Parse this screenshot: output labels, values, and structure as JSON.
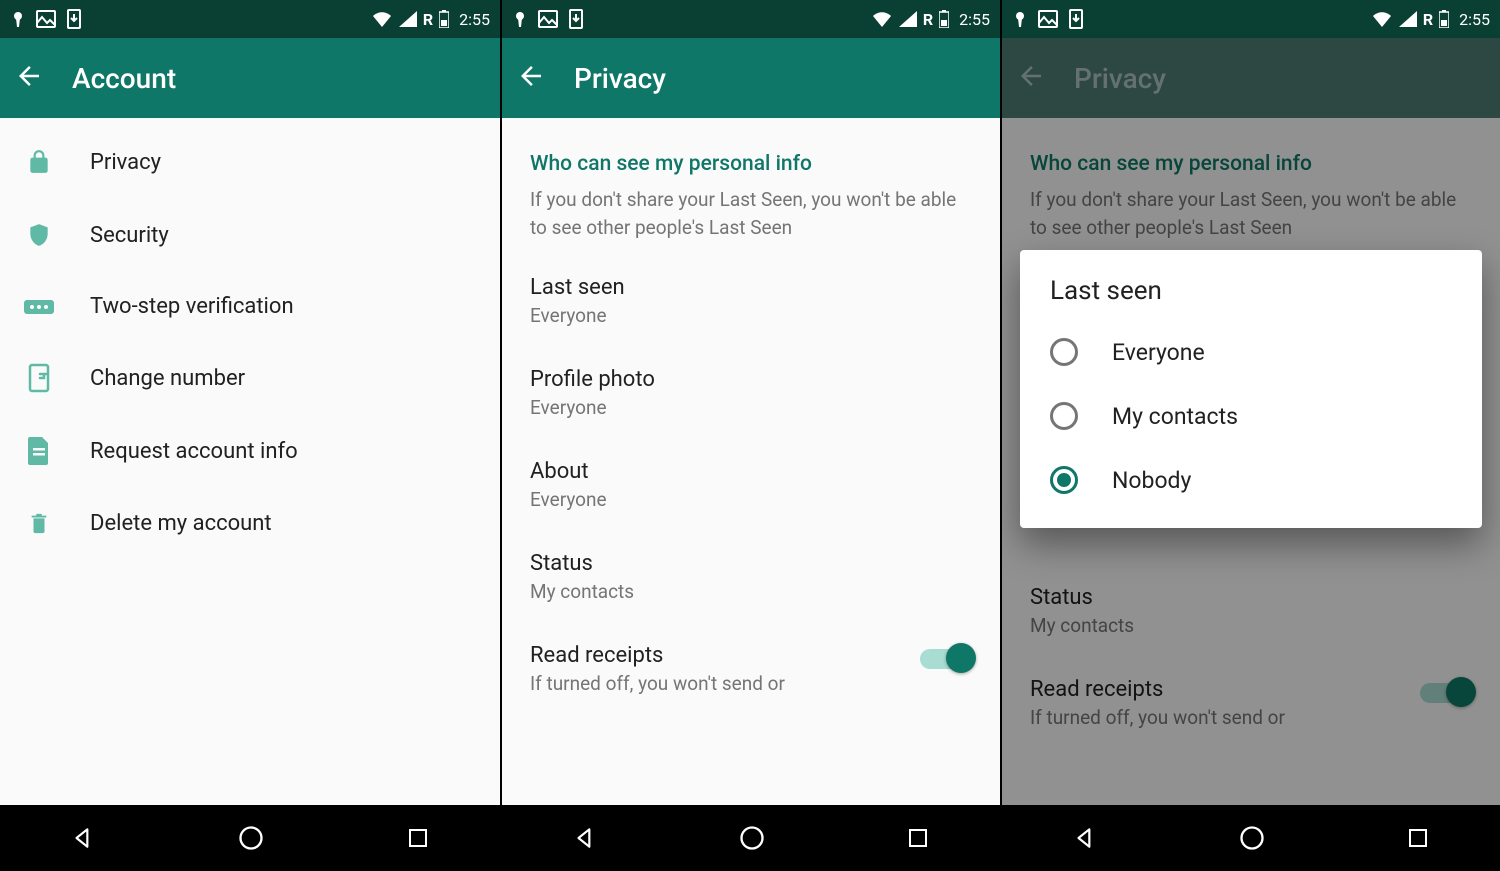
{
  "status": {
    "time": "2:55",
    "network": "R"
  },
  "screens": [
    {
      "title": "Account",
      "items": [
        {
          "name": "privacy",
          "label": "Privacy",
          "icon": "lock-icon"
        },
        {
          "name": "security",
          "label": "Security",
          "icon": "shield-icon"
        },
        {
          "name": "two-step",
          "label": "Two-step verification",
          "icon": "passcode-icon"
        },
        {
          "name": "change-number",
          "label": "Change number",
          "icon": "sim-icon"
        },
        {
          "name": "request-info",
          "label": "Request account info",
          "icon": "document-icon"
        },
        {
          "name": "delete-account",
          "label": "Delete my account",
          "icon": "trash-icon"
        }
      ]
    },
    {
      "title": "Privacy",
      "section_header": "Who can see my personal info",
      "section_caption": "If you don't share your Last Seen, you won't be able to see other people's Last Seen",
      "items": [
        {
          "name": "last-seen",
          "title": "Last seen",
          "sub": "Everyone"
        },
        {
          "name": "profile-photo",
          "title": "Profile photo",
          "sub": "Everyone"
        },
        {
          "name": "about",
          "title": "About",
          "sub": "Everyone"
        },
        {
          "name": "status",
          "title": "Status",
          "sub": "My contacts"
        }
      ],
      "read_receipts": {
        "title": "Read receipts",
        "sub": "If turned off, you won't send or",
        "on": true
      }
    },
    {
      "title": "Privacy",
      "section_header": "Who can see my personal info",
      "section_caption": "If you don't share your Last Seen, you won't be able to see other people's Last Seen",
      "items": [
        {
          "name": "status",
          "title": "Status",
          "sub": "My contacts"
        }
      ],
      "read_receipts": {
        "title": "Read receipts",
        "sub": "If turned off, you won't send or",
        "on": true
      },
      "dialog": {
        "title": "Last seen",
        "options": [
          {
            "label": "Everyone",
            "selected": false
          },
          {
            "label": "My contacts",
            "selected": false
          },
          {
            "label": "Nobody",
            "selected": true
          }
        ]
      }
    }
  ]
}
